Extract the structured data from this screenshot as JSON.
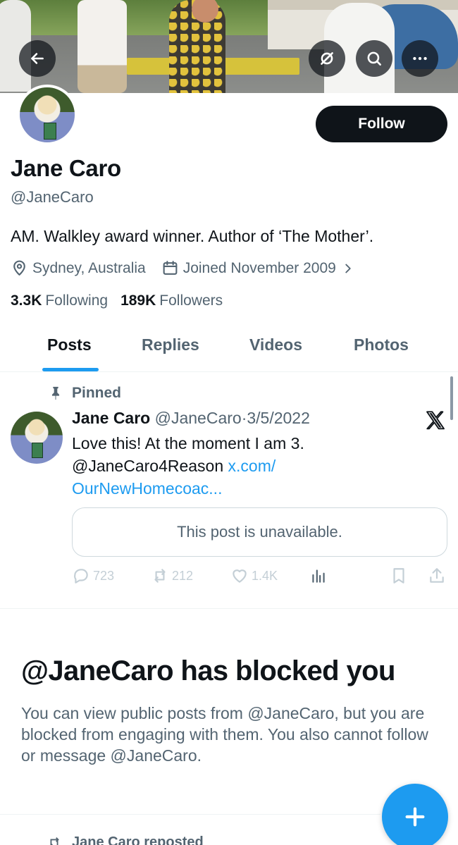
{
  "header": {
    "back_icon": "arrow-left-icon",
    "translate_icon": "no-translate-icon",
    "search_icon": "search-icon",
    "more_icon": "more-icon"
  },
  "profile": {
    "name": "Jane Caro",
    "handle": "@JaneCaro",
    "bio": "AM. Walkley award winner. Author of ‘The Mother’.",
    "location": "Sydney, Australia",
    "joined": "Joined November 2009",
    "following_count": "3.3K",
    "following_label": "Following",
    "followers_count": "189K",
    "followers_label": "Followers",
    "follow_label": "Follow"
  },
  "tabs": [
    {
      "label": "Posts",
      "active": true
    },
    {
      "label": "Replies",
      "active": false
    },
    {
      "label": "Videos",
      "active": false
    },
    {
      "label": "Photos",
      "active": false
    }
  ],
  "pinned_post": {
    "pinned_label": "Pinned",
    "author": "Jane Caro",
    "handle": "@JaneCaro",
    "separator": "·",
    "date": "3/5/2022",
    "text_line1": "Love this! At the moment I am 3.",
    "text_mention": "@JaneCaro4Reason",
    "text_link1": "x.com/",
    "text_link2": "OurNewHomecoac...",
    "unavailable": "This post is unavailable.",
    "replies": "723",
    "reposts": "212",
    "likes": "1.4K"
  },
  "blocked": {
    "title": "@JaneCaro has blocked you",
    "text": "You can view public posts from @JaneCaro, but you are blocked from engaging with them. You also cannot follow or message @JaneCaro."
  },
  "next_item": {
    "reposted": "Jane Caro reposted"
  },
  "colors": {
    "accent": "#1d9bf0",
    "text": "#0f1419",
    "secondary": "#536471"
  }
}
